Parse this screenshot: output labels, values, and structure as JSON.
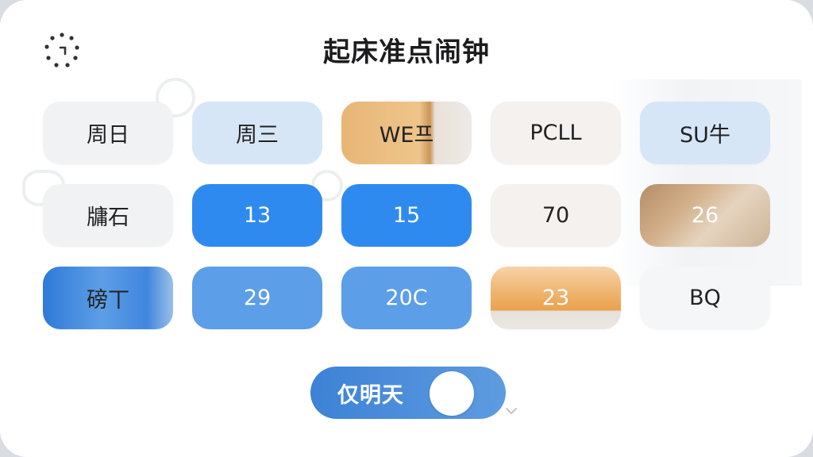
{
  "title": "起床准点闹钟",
  "icons": {
    "loading": "loading-spinner-icon",
    "dropdown": "chevron-down-icon"
  },
  "colors": {
    "accent_blue": "#2f8af0",
    "light_blue": "#d7e6f7",
    "toggle_blue": "#4a8cdb"
  },
  "grid": {
    "rows": [
      [
        {
          "label": "周日"
        },
        {
          "label": "周三"
        },
        {
          "label": "WE프"
        },
        {
          "label": "PCLL"
        },
        {
          "label": "SU牛"
        }
      ],
      [
        {
          "label": "牗石"
        },
        {
          "label": "13"
        },
        {
          "label": "15"
        },
        {
          "label": "70"
        },
        {
          "label": "26"
        }
      ],
      [
        {
          "label": "磅丅"
        },
        {
          "label": "29"
        },
        {
          "label": "20C"
        },
        {
          "label": "23"
        },
        {
          "label": "BQ"
        }
      ]
    ]
  },
  "toggle": {
    "label": "仅明天",
    "state": "on"
  }
}
